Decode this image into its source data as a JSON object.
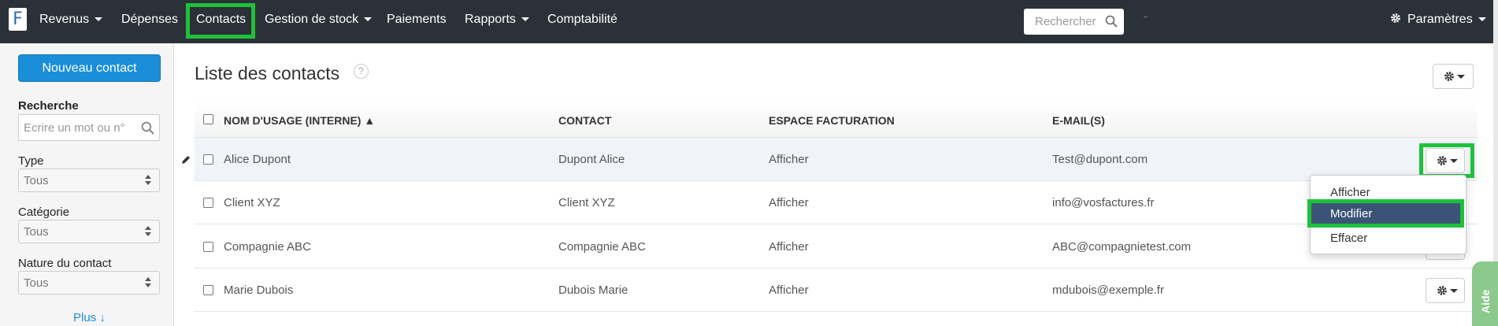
{
  "nav": {
    "logo": "F",
    "items": [
      {
        "label": "Revenus",
        "dropdown": true
      },
      {
        "label": "Dépenses",
        "dropdown": false
      },
      {
        "label": "Contacts",
        "dropdown": false,
        "active": true
      },
      {
        "label": "Gestion de stock",
        "dropdown": true
      },
      {
        "label": "Paiements",
        "dropdown": false
      },
      {
        "label": "Rapports",
        "dropdown": true
      },
      {
        "label": "Comptabilité",
        "dropdown": false
      }
    ],
    "search_placeholder": "Rechercher",
    "settings_label": "Paramètres"
  },
  "sidebar": {
    "new_button": "Nouveau contact",
    "search_label": "Recherche",
    "search_placeholder": "Ecrire un mot ou n°",
    "filters": [
      {
        "label": "Type",
        "value": "Tous"
      },
      {
        "label": "Catégorie",
        "value": "Tous"
      },
      {
        "label": "Nature du contact",
        "value": "Tous"
      }
    ],
    "more_label": "Plus ↓"
  },
  "main": {
    "title": "Liste des contacts",
    "help": "?",
    "columns": [
      "NOM D'USAGE (INTERNE) ▲",
      "CONTACT",
      "ESPACE FACTURATION",
      "E-MAIL(S)"
    ],
    "rows": [
      {
        "name": "Alice Dupont",
        "contact": "Dupont Alice",
        "billing": "Afficher",
        "email": "Test@dupont.com"
      },
      {
        "name": "Client XYZ",
        "contact": "Client XYZ",
        "billing": "Afficher",
        "email": "info@vosfactures.fr"
      },
      {
        "name": "Compagnie ABC",
        "contact": "Compagnie ABC",
        "billing": "Afficher",
        "email": "ABC@compagnietest.com"
      },
      {
        "name": "Marie Dubois",
        "contact": "Dubois Marie",
        "billing": "Afficher",
        "email": "mdubois@exemple.fr"
      }
    ],
    "row_menu": [
      "Afficher",
      "Modifier",
      "Effacer"
    ]
  },
  "aide": "Aide",
  "colors": {
    "nav_bg": "#2b3138",
    "primary": "#1a8ed9",
    "highlight": "#1fc13a",
    "menu_active": "#3c5378"
  }
}
